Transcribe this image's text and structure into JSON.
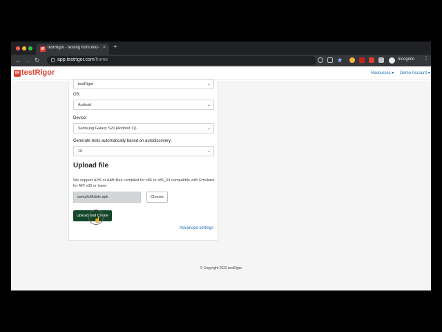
{
  "browser": {
    "traffic_lights": [
      "#ff5f57",
      "#febc2e",
      "#28c840"
    ],
    "tab": {
      "favicon": "tR",
      "title": "testRigor - testing from end-u",
      "close": "×"
    },
    "new_tab": "+",
    "nav": {
      "back": "←",
      "forward": "→",
      "reload": "↻",
      "home": "⌂"
    },
    "url_host": "app.testrigor.com",
    "url_path": "/home",
    "incognito_label": "Incognito",
    "menu": "⋮"
  },
  "app": {
    "logo_mark": "tR",
    "logo_text": "testRigor",
    "nav": {
      "resources": "Resources ▾",
      "account": "Demo Account ▾"
    }
  },
  "form": {
    "top_select_value": "testRigor",
    "os_label": "OS:",
    "os_value": "Android",
    "device_label": "Device:",
    "device_value": "Samsung Galaxy S20 (Android 11)",
    "autodiscovery_label": "Generate tests automatically based on autodiscovery:",
    "autodiscovery_value": "10",
    "upload_title": "Upload file",
    "upload_description": "We support APK or AAB files compiled for x86 or x86_64 compatible with Emulator for API v30 or lower",
    "file_name": "sampleMobile.apk",
    "choose_label": "Choose",
    "upload_button": "Upload and Create",
    "advanced_settings": "Advanced settings"
  },
  "footer": {
    "copyright": "© Copyright 2022 testRigor"
  },
  "colors": {
    "brand": "#e03e2f",
    "primary_button": "#14462a",
    "link": "#1f6fb4"
  }
}
